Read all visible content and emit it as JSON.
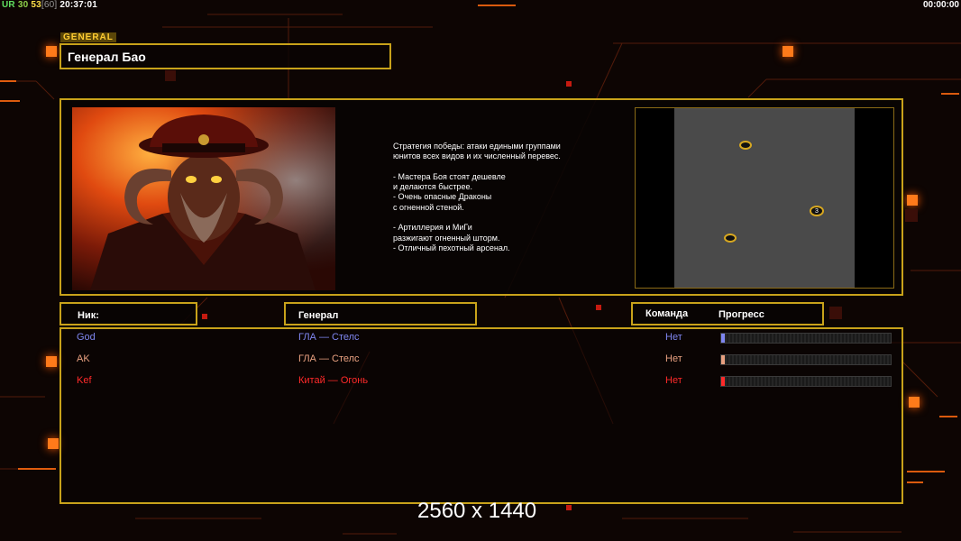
{
  "hud": {
    "ur_label": "UR",
    "value_1": "30",
    "value_2": "53",
    "value_3": "[60]",
    "clock": "20:37:01",
    "timer": "00:00:00"
  },
  "general": {
    "tag": "GENERAL",
    "name": "Генерал Бао",
    "description": "Стратегия победы: атаки едиными группами\nюнитов всех видов и их численный перевес.\n\n- Мастера Боя стоят дешевле\nи делаются быстрее.\n- Очень опасные Драконы\nс огненной стеной.\n\n- Артиллерия и МиГи\nразжигают огненный шторм.\n- Отличный пехотный арсенал."
  },
  "map": {
    "spawn_label": "3"
  },
  "columns": {
    "nick": "Ник:",
    "general": "Генерал",
    "team": "Команда",
    "progress": "Прогресс"
  },
  "players": [
    {
      "nick": "God",
      "general": "ГЛА — Стелс",
      "team": "Нет",
      "progress": 0.01,
      "color": "#7f86f0"
    },
    {
      "nick": "AK",
      "general": "ГЛА — Стелс",
      "team": "Нет",
      "progress": 0.01,
      "color": "#e8a080"
    },
    {
      "nick": "Kef",
      "general": "Китай — Огонь",
      "team": "Нет",
      "progress": 0.02,
      "color": "#ff2a2a"
    }
  ],
  "overlay": {
    "resolution": "2560 x 1440"
  },
  "colors": {
    "frame": "#c8a21a",
    "accent": "#ff7a1a"
  }
}
